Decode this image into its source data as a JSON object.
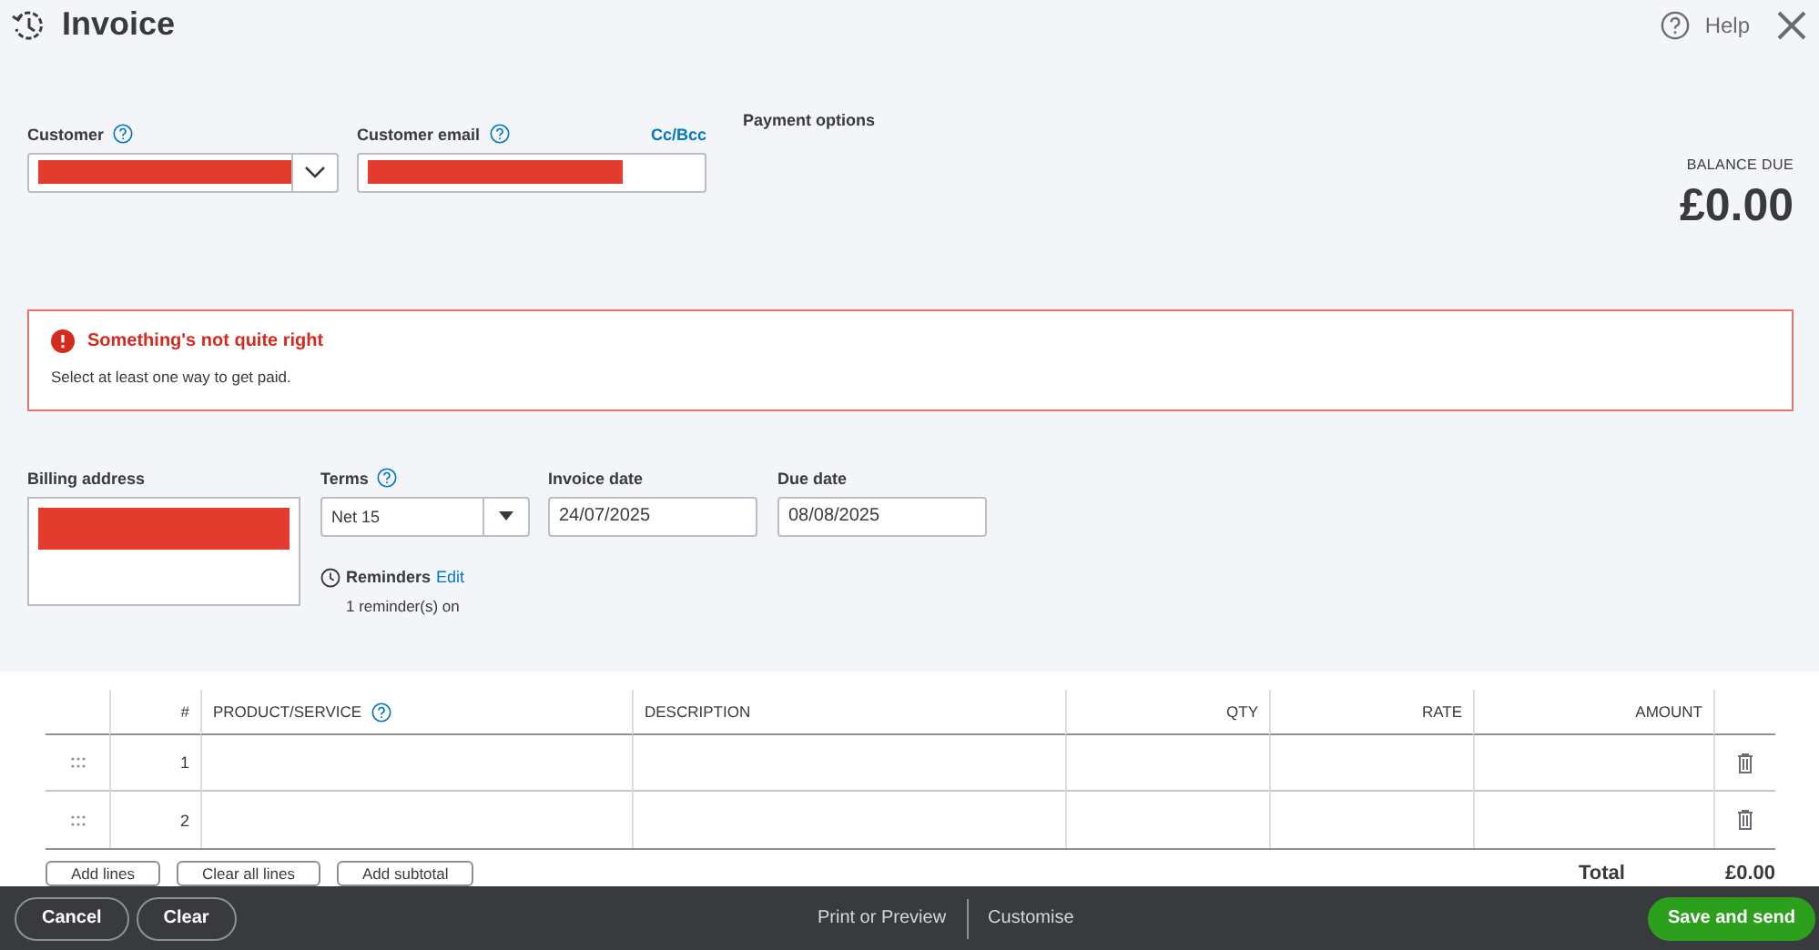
{
  "header": {
    "title": "Invoice",
    "help": "Help"
  },
  "customer": {
    "label": "Customer"
  },
  "customer_email": {
    "label": "Customer email",
    "link": "Cc/Bcc"
  },
  "payment_options": {
    "label": "Payment options"
  },
  "balance": {
    "label": "BALANCE DUE",
    "amount": "£0.00"
  },
  "alert": {
    "title": "Something's not quite right",
    "message": "Select at least one way to get paid."
  },
  "billing_address": {
    "label": "Billing address"
  },
  "terms": {
    "label": "Terms",
    "value": "Net 15"
  },
  "invoice_date": {
    "label": "Invoice date",
    "value": "24/07/2025"
  },
  "due_date": {
    "label": "Due date",
    "value": "08/08/2025"
  },
  "reminders": {
    "label": "Reminders",
    "link": "Edit",
    "status": "1 reminder(s) on"
  },
  "table": {
    "columns": [
      "#",
      "PRODUCT/SERVICE",
      "DESCRIPTION",
      "QTY",
      "RATE",
      "AMOUNT"
    ],
    "rows": [
      {
        "number": "1"
      },
      {
        "number": "2"
      }
    ]
  },
  "table_actions": [
    "Add lines",
    "Clear all lines",
    "Add subtotal"
  ],
  "total": {
    "label": "Total",
    "amount": "£0.00"
  },
  "footer": {
    "left_buttons": [
      "Cancel",
      "Clear"
    ],
    "center_links": [
      "Print or Preview",
      "Customise"
    ],
    "primary": "Save and send"
  }
}
